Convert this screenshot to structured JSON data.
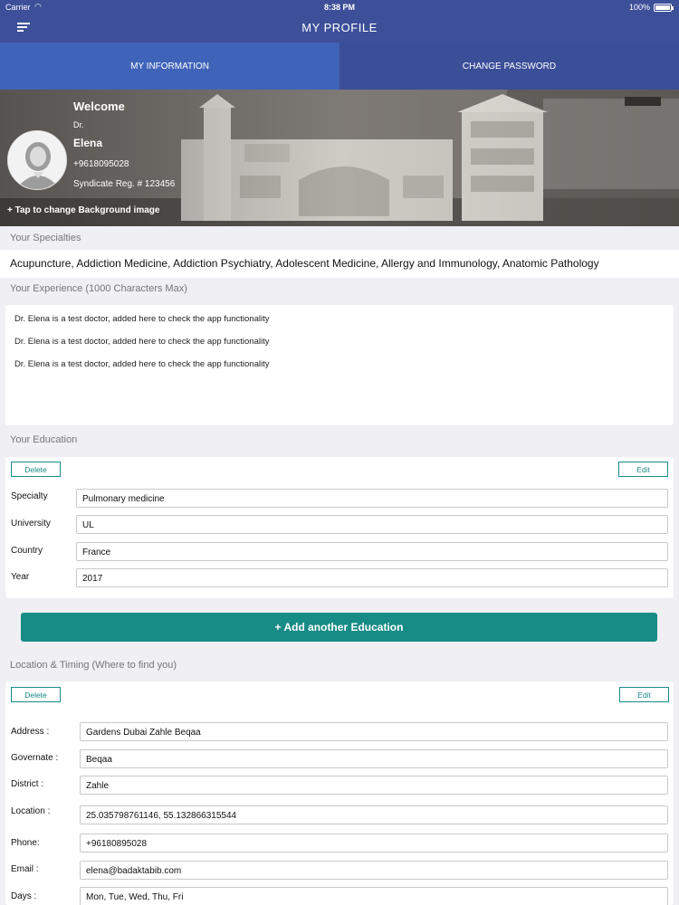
{
  "status": {
    "carrier": "Carrier",
    "time": "8:38 PM",
    "battery": "100%"
  },
  "header": {
    "title": "MY PROFILE",
    "menu_icon": "menu-icon"
  },
  "tabs": [
    {
      "label": "MY INFORMATION",
      "active": true
    },
    {
      "label": "CHANGE PASSWORD",
      "active": false
    }
  ],
  "profile": {
    "welcome": "Welcome",
    "prefix": "Dr.",
    "name": "Elena",
    "phone": "+9618095028",
    "syndicate": "Syndicate Reg. # 123456",
    "change_background": "+ Tap to change Background image"
  },
  "specialties": {
    "label": "Your Specialties",
    "value": "Acupuncture, Addiction Medicine, Addiction Psychiatry, Adolescent Medicine, Allergy and Immunology, Anatomic Pathology"
  },
  "experience": {
    "label": "Your Experience (1000 Characters Max)",
    "lines": [
      "Dr. Elena is a test doctor, added here to check the app functionality",
      "Dr. Elena is a test doctor, added here to check the app functionality",
      "Dr. Elena is a test doctor, added here to check the app functionality"
    ]
  },
  "education": {
    "label": "Your Education",
    "delete_label": "Delete",
    "edit_label": "Edit",
    "fields": [
      {
        "label": "Specialty",
        "value": "Pulmonary medicine"
      },
      {
        "label": "University",
        "value": "UL"
      },
      {
        "label": "Country",
        "value": "France"
      },
      {
        "label": "Year",
        "value": "2017"
      }
    ],
    "add_label": "+ Add another Education"
  },
  "location": {
    "label": "Location & Timing (Where to find you)",
    "delete_label": "Delete",
    "edit_label": "Edit",
    "fields": [
      {
        "label": "Address :",
        "value": "Gardens Dubai Zahle Beqaa"
      },
      {
        "label": "Governate :",
        "value": "Beqaa"
      },
      {
        "label": "District :",
        "value": "Zahle"
      },
      {
        "label": "Location :",
        "value": "25.035798761146, 55.132866315544"
      },
      {
        "label": "Phone:",
        "value": "+96180895028"
      },
      {
        "label": "Email :",
        "value": "elena@badaktabib.com"
      },
      {
        "label": "Days :",
        "value": "Mon, Tue, Wed, Thu, Fri"
      }
    ]
  },
  "colors": {
    "nav": "#3d4f99",
    "tab_active": "#3f63b8",
    "accent": "#178b86"
  }
}
